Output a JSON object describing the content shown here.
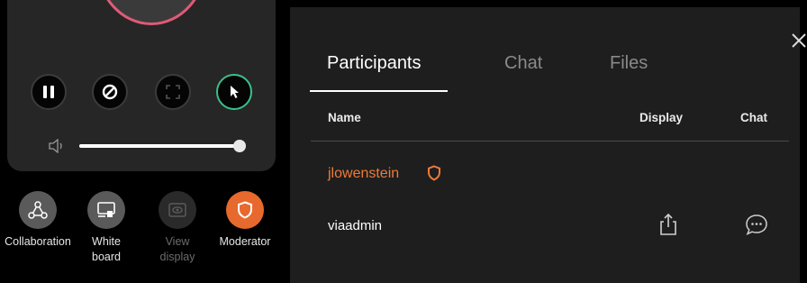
{
  "left_panel": {
    "controls": [
      {
        "icon": "pause-icon"
      },
      {
        "icon": "block-icon"
      },
      {
        "icon": "fullscreen-icon",
        "disabled": true
      },
      {
        "icon": "pointer-icon",
        "active": true
      }
    ],
    "volume": {
      "icon": "speaker-icon",
      "level": 1.0
    }
  },
  "tools": {
    "collaboration": {
      "label": "Collaboration",
      "icon": "collaboration-icon"
    },
    "whiteboard": {
      "label_line1": "White",
      "label_line2": "board",
      "icon": "whiteboard-icon"
    },
    "view_display": {
      "label_line1": "View",
      "label_line2": "display",
      "icon": "eye-icon",
      "disabled": true
    },
    "moderator": {
      "label": "Moderator",
      "icon": "shield-icon",
      "active": true
    }
  },
  "participants_panel": {
    "tabs": [
      {
        "label": "Participants",
        "active": true
      },
      {
        "label": "Chat"
      },
      {
        "label": "Files"
      }
    ],
    "columns": {
      "name": "Name",
      "display": "Display",
      "chat": "Chat"
    },
    "rows": [
      {
        "name": "jlowenstein",
        "is_moderator": true
      },
      {
        "name": "viaadmin",
        "is_moderator": false
      }
    ],
    "close_icon": "close-icon"
  },
  "colors": {
    "accent_orange": "#e8692e",
    "moderator_name": "#f07a3a",
    "pointer_active": "#3cbf8c",
    "preview_ring": "#e05a78"
  }
}
